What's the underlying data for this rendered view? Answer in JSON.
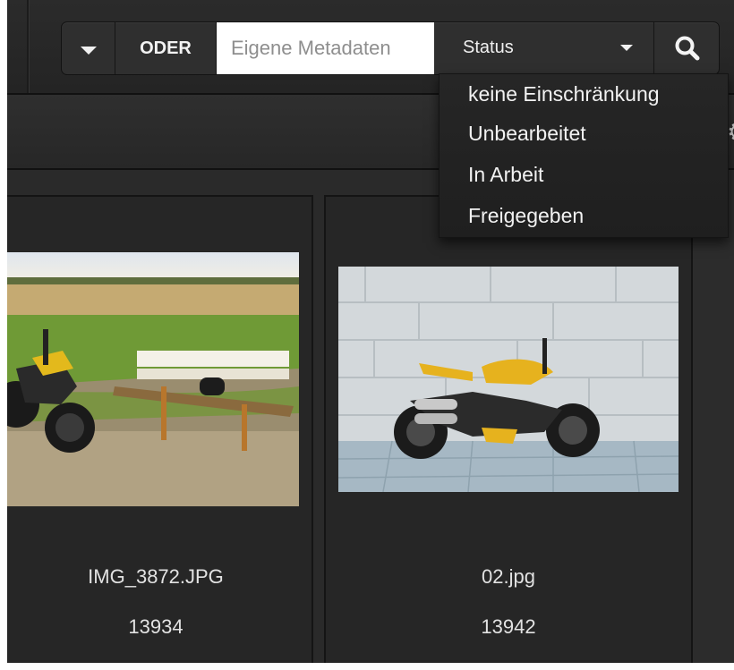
{
  "search": {
    "operator_label": "ODER",
    "metadata_placeholder": "Eigene Metadaten",
    "status_label": "Status",
    "status_options": [
      "keine Einschränkung",
      "Unbearbeitet",
      "In Arbeit",
      "Freigegeben"
    ]
  },
  "icons": {
    "dropdown": "chevron-down-icon",
    "search": "search-icon"
  },
  "items": [
    {
      "name": "IMG_3872.JPG",
      "id": "13934"
    },
    {
      "name": "02.jpg",
      "id": "13942"
    }
  ],
  "colors": {
    "background": "#232323",
    "accent_yellow": "#e6b21e"
  }
}
